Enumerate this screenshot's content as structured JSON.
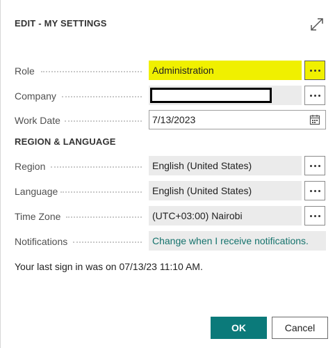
{
  "dialog": {
    "title": "EDIT - MY SETTINGS"
  },
  "fields": {
    "role": {
      "label": "Role",
      "value": "Administration"
    },
    "company": {
      "label": "Company",
      "value": ""
    },
    "work_date": {
      "label": "Work Date",
      "value": "7/13/2023"
    }
  },
  "region_section": {
    "title": "REGION & LANGUAGE",
    "region": {
      "label": "Region",
      "value": "English (United States)"
    },
    "language": {
      "label": "Language",
      "value": "English (United States)"
    },
    "time_zone": {
      "label": "Time Zone",
      "value": "(UTC+03:00) Nairobi"
    },
    "notifications": {
      "label": "Notifications",
      "value": "Change when I receive notifications."
    }
  },
  "last_sign_in": "Your last sign in was on 07/13/23 11:10 AM.",
  "buttons": {
    "ok": "OK",
    "cancel": "Cancel"
  },
  "colors": {
    "accent": "#0b7a7a",
    "highlight": "#f0f000",
    "link": "#14726c"
  },
  "icons": {
    "expand": "expand-icon",
    "lookup": "ellipsis-icon",
    "calendar": "calendar-icon"
  }
}
